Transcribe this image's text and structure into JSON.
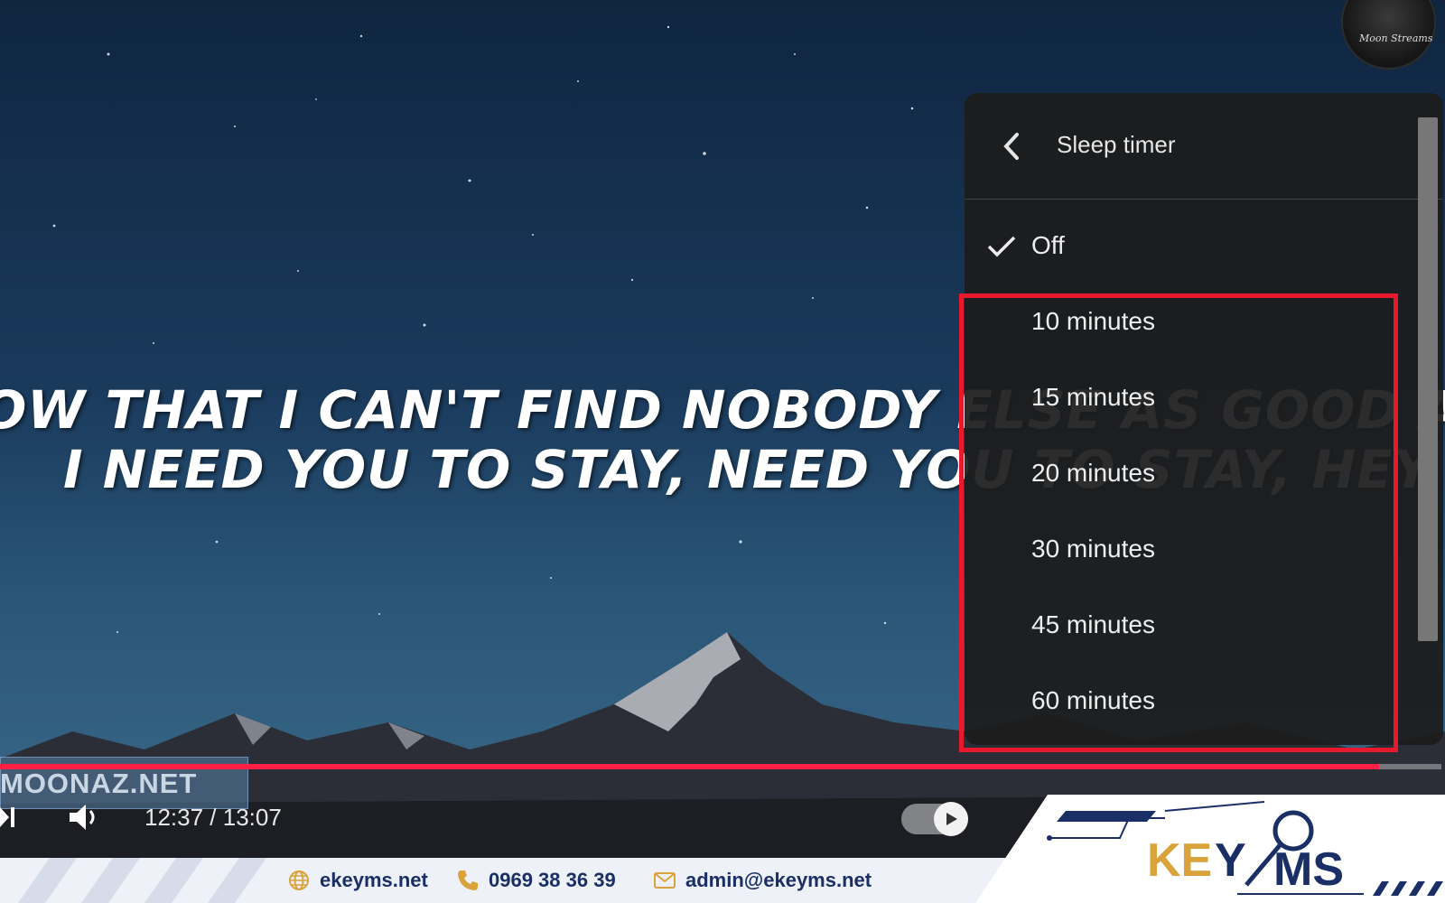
{
  "video": {
    "lyrics": [
      "OW THAT I CAN'T FIND NOBODY ELSE AS GOOD AS YOU",
      "I NEED YOU TO STAY, NEED YOU TO STAY, HEY"
    ],
    "channel_logo_text": "Moon Streams"
  },
  "player": {
    "watermark": "MOONAZ.NET",
    "time": "12:37 / 13:07",
    "progress": 0.957,
    "autoplay_on": true
  },
  "sleep_timer_menu": {
    "title": "Sleep timer",
    "options": [
      {
        "label": "Off",
        "selected": true
      },
      {
        "label": "10 minutes",
        "selected": false
      },
      {
        "label": "15 minutes",
        "selected": false
      },
      {
        "label": "20 minutes",
        "selected": false
      },
      {
        "label": "30 minutes",
        "selected": false
      },
      {
        "label": "45 minutes",
        "selected": false
      },
      {
        "label": "60 minutes",
        "selected": false
      }
    ]
  },
  "footer": {
    "website": "ekeyms.net",
    "phone": "0969 38 36 39",
    "email": "admin@ekeyms.net",
    "brand": "KEYMS"
  },
  "colors": {
    "progress": "#ff1f45",
    "highlight": "#e8192c",
    "brand_blue": "#1a2f66",
    "brand_gold": "#d9a23a"
  }
}
